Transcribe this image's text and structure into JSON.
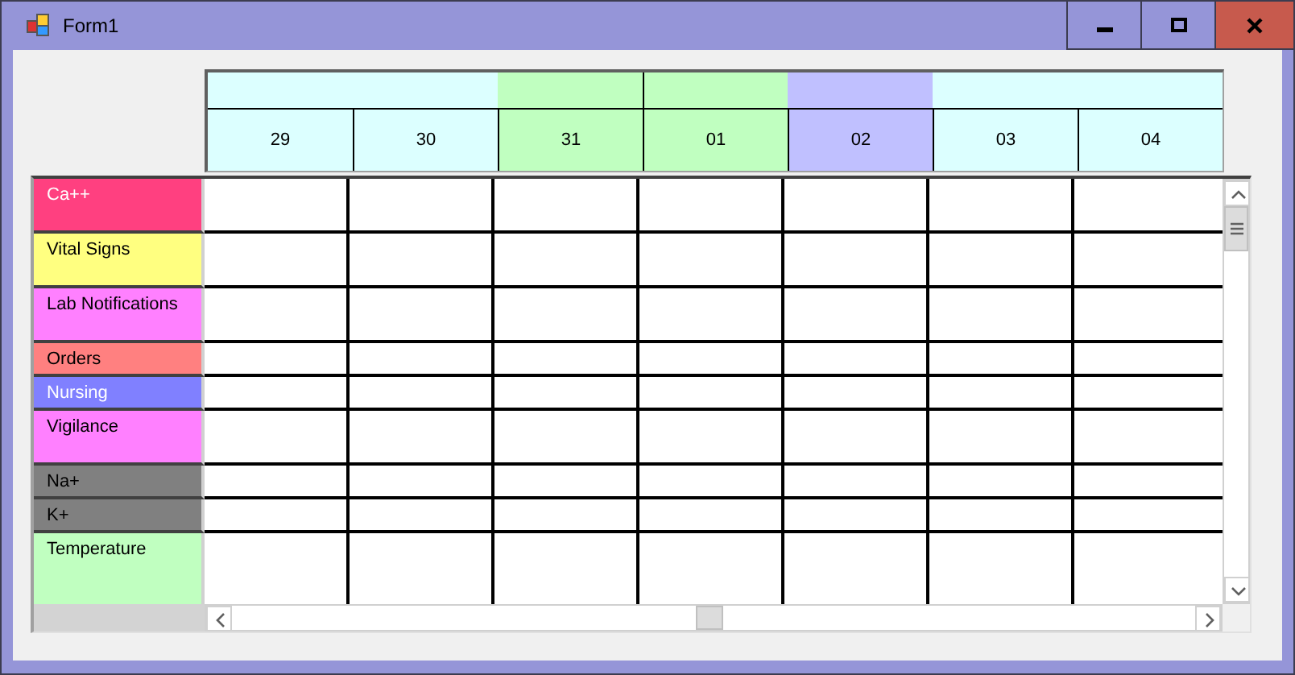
{
  "window": {
    "title": "Form1"
  },
  "days": [
    {
      "label": "29",
      "color": "#dcffff",
      "band": {
        "color": "#dcffff",
        "divider": false
      }
    },
    {
      "label": "30",
      "color": "#dcffff",
      "band": {
        "color": "#dcffff",
        "divider": false
      }
    },
    {
      "label": "31",
      "color": "#c0ffc0",
      "band": {
        "color": "#c0ffc0",
        "divider": false
      }
    },
    {
      "label": "01",
      "color": "#c0ffc0",
      "band": {
        "color": "#c0ffc0",
        "divider": true
      }
    },
    {
      "label": "02",
      "color": "#c0c0ff",
      "band": {
        "color": "#c0c0ff",
        "divider": false
      }
    },
    {
      "label": "03",
      "color": "#dcffff",
      "band": {
        "color": "#dcffff",
        "divider": false
      }
    },
    {
      "label": "04",
      "color": "#dcffff",
      "band": {
        "color": "#dcffff",
        "divider": false
      }
    }
  ],
  "rows": [
    {
      "label": "Ca++",
      "color": "#ff4080",
      "light_text": true,
      "kind": "tall"
    },
    {
      "label": "Vital Signs",
      "color": "#ffff80",
      "light_text": false,
      "kind": "tall"
    },
    {
      "label": "Lab Notifications",
      "color": "#ff80ff",
      "light_text": false,
      "kind": "tall"
    },
    {
      "label": "Orders",
      "color": "#ff8080",
      "light_text": false,
      "kind": "short"
    },
    {
      "label": "Nursing",
      "color": "#8080ff",
      "light_text": true,
      "kind": "short"
    },
    {
      "label": "Vigilance",
      "color": "#ff80ff",
      "light_text": false,
      "kind": "tall"
    },
    {
      "label": "Na+",
      "color": "#808080",
      "light_text": false,
      "kind": "short"
    },
    {
      "label": "K+",
      "color": "#808080",
      "light_text": false,
      "kind": "short"
    },
    {
      "label": "Temperature",
      "color": "#c0ffc0",
      "light_text": false,
      "kind": "fill"
    }
  ]
}
